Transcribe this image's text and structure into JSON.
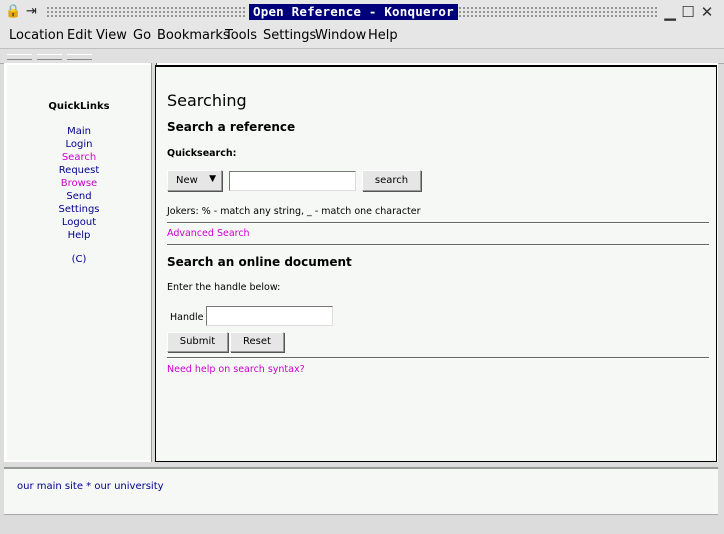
{
  "window": {
    "title": "Open Reference - Konqueror"
  },
  "menubar": {
    "items": [
      {
        "label": "Location"
      },
      {
        "label": "Edit"
      },
      {
        "label": "View"
      },
      {
        "label": "Go"
      },
      {
        "label": "Bookmarks"
      },
      {
        "label": "Tools"
      },
      {
        "label": "Settings"
      },
      {
        "label": "Window"
      },
      {
        "label": "Help"
      }
    ]
  },
  "quicklinks": {
    "title": "QuickLinks",
    "links": [
      {
        "label": "Main",
        "color": "#00008b"
      },
      {
        "label": "Login",
        "color": "#00008b"
      },
      {
        "label": "Search",
        "color": "#cc00cc"
      },
      {
        "label": "Request",
        "color": "#00008b"
      },
      {
        "label": "Browse",
        "color": "#cc00cc"
      },
      {
        "label": "Send",
        "color": "#00008b"
      },
      {
        "label": "Settings",
        "color": "#00008b"
      },
      {
        "label": "Logout",
        "color": "#00008b"
      },
      {
        "label": "Help",
        "color": "#00008b"
      }
    ],
    "copyright": "(C)"
  },
  "main": {
    "heading": "Searching",
    "search_ref_heading": "Search a reference",
    "quicksearch_label": "Quicksearch:",
    "select_value": "New",
    "search_value": "",
    "search_button": "search",
    "jokers_text": "Jokers: % - match any string, _ - match one character",
    "advanced_link": "Advanced Search",
    "online_doc_heading": "Search an online document",
    "enter_handle_text": "Enter the handle below:",
    "handle_label": "Handle",
    "handle_value": "",
    "submit_button": "Submit",
    "reset_button": "Reset",
    "help_link": "Need help on search syntax?"
  },
  "bottom": {
    "links_text": "our main site * our university"
  },
  "colors": {
    "accent_title_bg": "#00007a",
    "link_blue": "#00008b",
    "link_visited": "#cc00cc"
  }
}
